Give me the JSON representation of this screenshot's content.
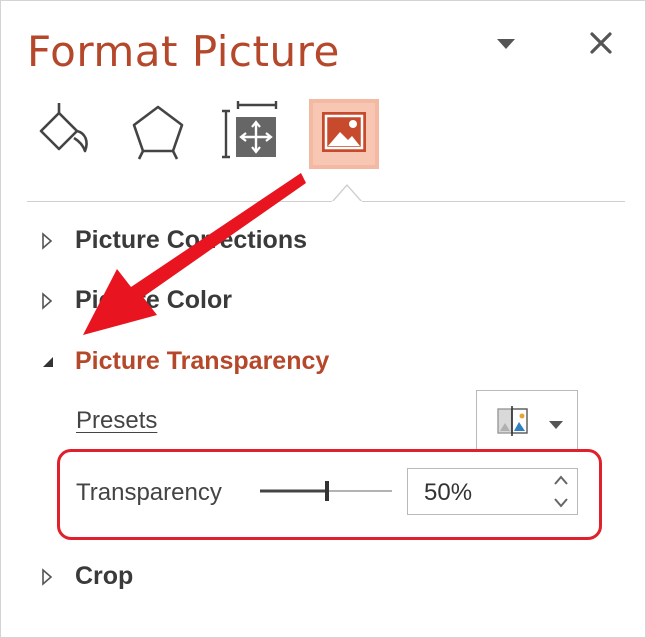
{
  "pane": {
    "title": "Format Picture",
    "menu_icon": "chevron-down-icon",
    "close_icon": "close-icon"
  },
  "tabs": [
    {
      "name": "Fill & Line",
      "icon": "paint-bucket-icon",
      "active": false
    },
    {
      "name": "Effects",
      "icon": "pentagon-icon",
      "active": false
    },
    {
      "name": "Size & Properties",
      "icon": "size-properties-icon",
      "active": false
    },
    {
      "name": "Picture",
      "icon": "picture-icon",
      "active": true
    }
  ],
  "sections": [
    {
      "label": "Picture Corrections",
      "expanded": false
    },
    {
      "label": "Picture Color",
      "expanded": false
    },
    {
      "label": "Picture Transparency",
      "expanded": true
    },
    {
      "label": "Crop",
      "expanded": false
    }
  ],
  "transparency": {
    "presets_label": "Presets",
    "transparency_label": "Transparency",
    "value": "50%",
    "slider_percent": 50
  },
  "colors": {
    "accent": "#b5472b",
    "active_tab": "#f4b9a3",
    "annotation_red": "#e0202b"
  }
}
